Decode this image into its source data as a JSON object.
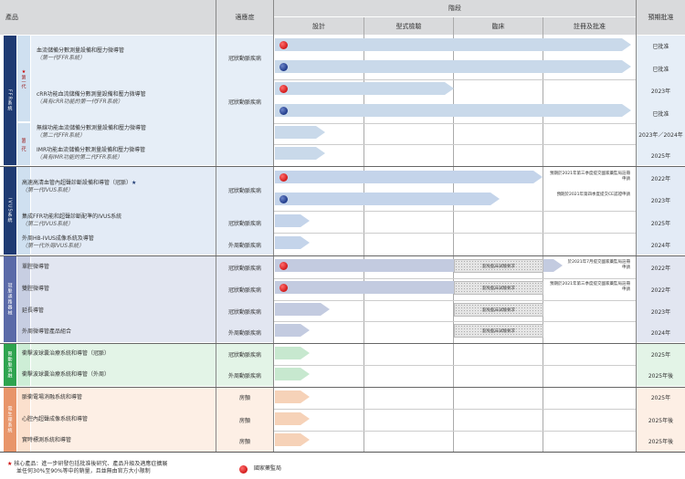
{
  "headers": {
    "product": "產品",
    "indication": "適應症",
    "stage": "階段",
    "design": "設計",
    "type_test": "型式檢驗",
    "clinical": "臨床",
    "registration": "註冊及批准",
    "expected_approval": "預期批准"
  },
  "categories": [
    {
      "label": "FFR系統",
      "color": "#1f3b73"
    },
    {
      "label": "IVUS系統",
      "color": "#1f3b73"
    },
    {
      "label": "冠脈通路器械",
      "color": "#5a6aa8"
    },
    {
      "label": "腎動脈消融",
      "color": "#2ea44f"
    },
    {
      "label": "電生理系統",
      "color": "#e8956a"
    }
  ],
  "subgroups": [
    {
      "label": "第一代"
    },
    {
      "label": "第二代"
    }
  ],
  "products": [
    {
      "name": "血流儲備分數測量設備和壓力微導管",
      "sub": "（第一代FFR系統）",
      "indication": "冠狀動脈疾病",
      "approval": ""
    },
    {
      "name": "",
      "sub": "",
      "indication": "",
      "approval": "已批准"
    },
    {
      "name": "",
      "sub": "",
      "indication": "",
      "approval": "已批准"
    },
    {
      "name": "cRR功能血流儲備分數測量設備和壓力微導管",
      "sub": "（具有cRR功能的第一代FFR系統）",
      "indication": "冠狀動脈疾病",
      "approval": ""
    },
    {
      "name": "",
      "sub": "",
      "indication": "",
      "approval": "2023年"
    },
    {
      "name": "",
      "sub": "",
      "indication": "",
      "approval": "已批准"
    },
    {
      "name": "無線功能血流儲備分數測量設備和壓力微導管",
      "sub": "（第二代FFR系統）",
      "indication": "",
      "approval": "2023年／2024年"
    },
    {
      "name": "IMR功能血流儲備分數測量設備和壓力微導管",
      "sub": "（具有IMR功能的第二代FFR系統）",
      "indication": "",
      "approval": "2025年"
    },
    {
      "name": "高速高清血管內超聲診斷設備和導管（冠脈）",
      "sub": "（第一代IVUS系統）",
      "indication": "冠狀動脈疾病",
      "approval": ""
    },
    {
      "name": "",
      "sub": "",
      "indication": "",
      "approval": "2022年"
    },
    {
      "name": "",
      "sub": "",
      "indication": "",
      "approval": "2023年"
    },
    {
      "name": "集成FFR功能和超聲診斷配準的IVUS系統",
      "sub": "（第二代IVUS系統）",
      "indication": "冠狀動脈疾病",
      "approval": "2025年"
    },
    {
      "name": "外周HB-IVUS成像系統及導管",
      "sub": "（第一代外周IVUS系統）",
      "indication": "外周動脈疾病",
      "approval": "2024年"
    },
    {
      "name": "單腔微導管",
      "sub": "",
      "indication": "冠狀動脈疾病",
      "approval": "2022年"
    },
    {
      "name": "雙腔微導管",
      "sub": "",
      "indication": "冠狀動脈疾病",
      "approval": "2022年"
    },
    {
      "name": "延長導管",
      "sub": "",
      "indication": "冠狀動脈疾病",
      "approval": "2023年"
    },
    {
      "name": "外周微導管產品組合",
      "sub": "",
      "indication": "外周動脈疾病",
      "approval": "2024年"
    },
    {
      "name": "衝擊波球囊治療系統和導管（冠脈）",
      "sub": "",
      "indication": "冠狀動脈疾病",
      "approval": "2025年"
    },
    {
      "name": "衝擊波球囊治療系統和導管（外周）",
      "sub": "",
      "indication": "外周動脈疾病",
      "approval": "2025年後"
    },
    {
      "name": "脈衝電場消融系統和導管",
      "sub": "",
      "indication": "房顫",
      "approval": "2025年"
    },
    {
      "name": "心腔內超聲成像系統和導管",
      "sub": "",
      "indication": "房顫",
      "approval": "2025年後"
    },
    {
      "name": "實時標測系統和導管",
      "sub": "",
      "indication": "房顫",
      "approval": "2025年後"
    }
  ],
  "notes": {
    "n1": "預期於2021年第三季度提交國家藥監局註冊申請",
    "n2": "預期於2021年第四季度提交CE認證申請",
    "n3": "於2021年7月提交國家藥監局註冊申請",
    "n4": "預期於2021年第三季度提交國家藥監局註冊申請",
    "exempt": "豁免臨床試驗要求"
  },
  "footer": {
    "star": "★",
    "core": "核心產品：進一步研發包括批准後研究、產品升級及適應症擴展",
    "core2": "並任何30%至90%等中的銷量，且並無由官方大小限制",
    "legend": "國家藥監局"
  },
  "colors": {
    "ffr_arrow": "#c9d9ea",
    "ivus_arrow": "#c4d4ea",
    "micro_arrow": "#c3cbe0",
    "shock_arrow": "#c7e8cf",
    "ep_arrow": "#f6d2b8"
  }
}
